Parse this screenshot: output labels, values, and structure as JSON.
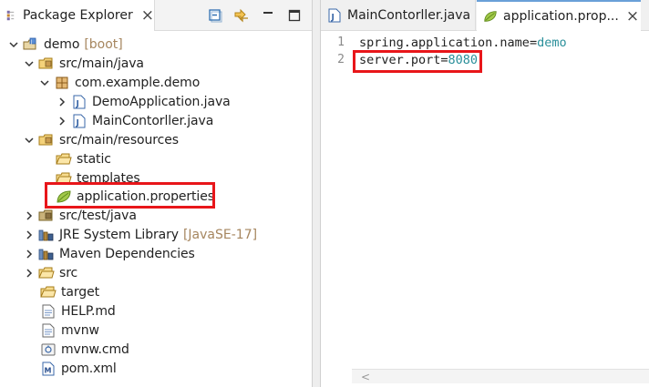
{
  "explorer": {
    "tab_label": "Package Explorer",
    "close_glyph": "×",
    "tools": [
      "collapse-all-icon",
      "link-with-editor-icon",
      "view-menu-icon",
      "maximize-icon"
    ]
  },
  "tree": [
    {
      "label": "demo",
      "decoration": "[boot]",
      "icon": "project-icon",
      "expanded": true
    },
    {
      "label": "src/main/java",
      "icon": "source-folder-icon",
      "expanded": true
    },
    {
      "label": "com.example.demo",
      "icon": "package-icon",
      "expanded": true
    },
    {
      "label": "DemoApplication.java",
      "icon": "java-file-icon",
      "expanded": false
    },
    {
      "label": "MainContorller.java",
      "icon": "java-file-icon",
      "expanded": false
    },
    {
      "label": "src/main/resources",
      "icon": "source-folder-icon",
      "expanded": true
    },
    {
      "label": "static",
      "icon": "folder-icon"
    },
    {
      "label": "templates",
      "icon": "folder-icon"
    },
    {
      "label": "application.properties",
      "icon": "spring-leaf-icon"
    },
    {
      "label": "src/test/java",
      "icon": "source-folder-icon",
      "expanded": false
    },
    {
      "label": "JRE System Library",
      "decoration": "[JavaSE-17]",
      "icon": "library-icon",
      "expanded": false
    },
    {
      "label": "Maven Dependencies",
      "icon": "library-icon",
      "expanded": false
    },
    {
      "label": "src",
      "icon": "folder-icon",
      "expanded": false
    },
    {
      "label": "target",
      "icon": "folder-icon"
    },
    {
      "label": "HELP.md",
      "icon": "text-file-icon"
    },
    {
      "label": "mvnw",
      "icon": "text-file-icon"
    },
    {
      "label": "mvnw.cmd",
      "icon": "cmd-file-icon"
    },
    {
      "label": "pom.xml",
      "icon": "maven-pom-icon"
    }
  ],
  "editor": {
    "tabs": [
      {
        "label": "MainContorller.java",
        "icon": "java-file-icon",
        "active": false
      },
      {
        "label": "application.prop...",
        "icon": "spring-leaf-icon",
        "active": true
      }
    ],
    "lines": [
      {
        "number": "1",
        "key": "spring.application.name",
        "sep": "=",
        "value": "demo"
      },
      {
        "number": "2",
        "key": "server.port",
        "sep": "=",
        "value": "8080"
      }
    ],
    "scroll_arrow": "<"
  },
  "colors": {
    "highlight": "#e8161a",
    "property_value": "#2a8f9a",
    "decoration": "#a6865f"
  }
}
